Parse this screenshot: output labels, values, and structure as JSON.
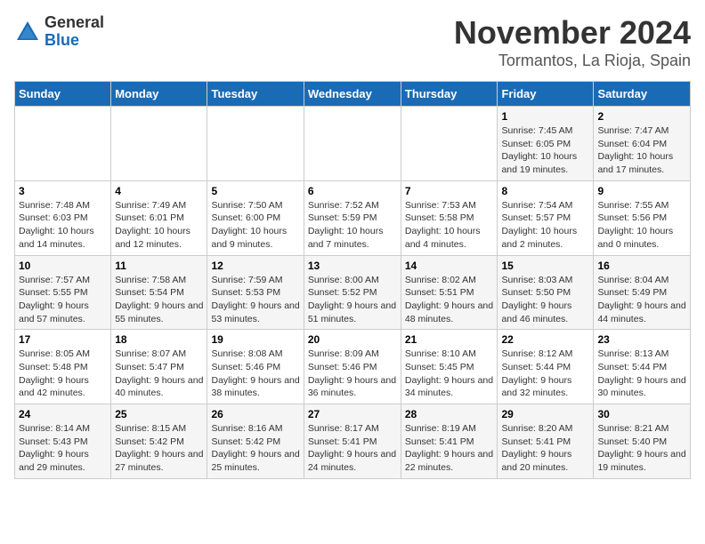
{
  "header": {
    "logo_line1": "General",
    "logo_line2": "Blue",
    "month": "November 2024",
    "location": "Tormantos, La Rioja, Spain"
  },
  "days_of_week": [
    "Sunday",
    "Monday",
    "Tuesday",
    "Wednesday",
    "Thursday",
    "Friday",
    "Saturday"
  ],
  "weeks": [
    [
      {
        "day": "",
        "info": ""
      },
      {
        "day": "",
        "info": ""
      },
      {
        "day": "",
        "info": ""
      },
      {
        "day": "",
        "info": ""
      },
      {
        "day": "",
        "info": ""
      },
      {
        "day": "1",
        "info": "Sunrise: 7:45 AM\nSunset: 6:05 PM\nDaylight: 10 hours and 19 minutes."
      },
      {
        "day": "2",
        "info": "Sunrise: 7:47 AM\nSunset: 6:04 PM\nDaylight: 10 hours and 17 minutes."
      }
    ],
    [
      {
        "day": "3",
        "info": "Sunrise: 7:48 AM\nSunset: 6:03 PM\nDaylight: 10 hours and 14 minutes."
      },
      {
        "day": "4",
        "info": "Sunrise: 7:49 AM\nSunset: 6:01 PM\nDaylight: 10 hours and 12 minutes."
      },
      {
        "day": "5",
        "info": "Sunrise: 7:50 AM\nSunset: 6:00 PM\nDaylight: 10 hours and 9 minutes."
      },
      {
        "day": "6",
        "info": "Sunrise: 7:52 AM\nSunset: 5:59 PM\nDaylight: 10 hours and 7 minutes."
      },
      {
        "day": "7",
        "info": "Sunrise: 7:53 AM\nSunset: 5:58 PM\nDaylight: 10 hours and 4 minutes."
      },
      {
        "day": "8",
        "info": "Sunrise: 7:54 AM\nSunset: 5:57 PM\nDaylight: 10 hours and 2 minutes."
      },
      {
        "day": "9",
        "info": "Sunrise: 7:55 AM\nSunset: 5:56 PM\nDaylight: 10 hours and 0 minutes."
      }
    ],
    [
      {
        "day": "10",
        "info": "Sunrise: 7:57 AM\nSunset: 5:55 PM\nDaylight: 9 hours and 57 minutes."
      },
      {
        "day": "11",
        "info": "Sunrise: 7:58 AM\nSunset: 5:54 PM\nDaylight: 9 hours and 55 minutes."
      },
      {
        "day": "12",
        "info": "Sunrise: 7:59 AM\nSunset: 5:53 PM\nDaylight: 9 hours and 53 minutes."
      },
      {
        "day": "13",
        "info": "Sunrise: 8:00 AM\nSunset: 5:52 PM\nDaylight: 9 hours and 51 minutes."
      },
      {
        "day": "14",
        "info": "Sunrise: 8:02 AM\nSunset: 5:51 PM\nDaylight: 9 hours and 48 minutes."
      },
      {
        "day": "15",
        "info": "Sunrise: 8:03 AM\nSunset: 5:50 PM\nDaylight: 9 hours and 46 minutes."
      },
      {
        "day": "16",
        "info": "Sunrise: 8:04 AM\nSunset: 5:49 PM\nDaylight: 9 hours and 44 minutes."
      }
    ],
    [
      {
        "day": "17",
        "info": "Sunrise: 8:05 AM\nSunset: 5:48 PM\nDaylight: 9 hours and 42 minutes."
      },
      {
        "day": "18",
        "info": "Sunrise: 8:07 AM\nSunset: 5:47 PM\nDaylight: 9 hours and 40 minutes."
      },
      {
        "day": "19",
        "info": "Sunrise: 8:08 AM\nSunset: 5:46 PM\nDaylight: 9 hours and 38 minutes."
      },
      {
        "day": "20",
        "info": "Sunrise: 8:09 AM\nSunset: 5:46 PM\nDaylight: 9 hours and 36 minutes."
      },
      {
        "day": "21",
        "info": "Sunrise: 8:10 AM\nSunset: 5:45 PM\nDaylight: 9 hours and 34 minutes."
      },
      {
        "day": "22",
        "info": "Sunrise: 8:12 AM\nSunset: 5:44 PM\nDaylight: 9 hours and 32 minutes."
      },
      {
        "day": "23",
        "info": "Sunrise: 8:13 AM\nSunset: 5:44 PM\nDaylight: 9 hours and 30 minutes."
      }
    ],
    [
      {
        "day": "24",
        "info": "Sunrise: 8:14 AM\nSunset: 5:43 PM\nDaylight: 9 hours and 29 minutes."
      },
      {
        "day": "25",
        "info": "Sunrise: 8:15 AM\nSunset: 5:42 PM\nDaylight: 9 hours and 27 minutes."
      },
      {
        "day": "26",
        "info": "Sunrise: 8:16 AM\nSunset: 5:42 PM\nDaylight: 9 hours and 25 minutes."
      },
      {
        "day": "27",
        "info": "Sunrise: 8:17 AM\nSunset: 5:41 PM\nDaylight: 9 hours and 24 minutes."
      },
      {
        "day": "28",
        "info": "Sunrise: 8:19 AM\nSunset: 5:41 PM\nDaylight: 9 hours and 22 minutes."
      },
      {
        "day": "29",
        "info": "Sunrise: 8:20 AM\nSunset: 5:41 PM\nDaylight: 9 hours and 20 minutes."
      },
      {
        "day": "30",
        "info": "Sunrise: 8:21 AM\nSunset: 5:40 PM\nDaylight: 9 hours and 19 minutes."
      }
    ]
  ]
}
